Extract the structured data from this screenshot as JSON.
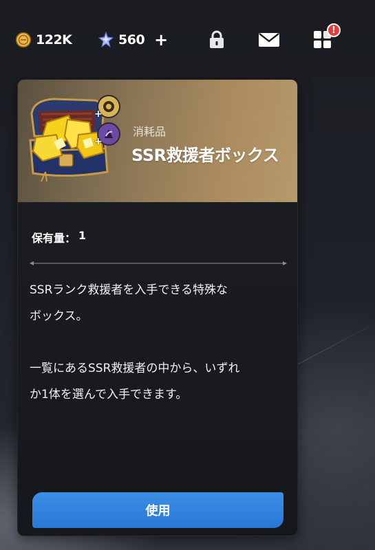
{
  "topbar": {
    "coins": {
      "icon": "coin-icon",
      "value": "122K"
    },
    "gems": {
      "icon": "gem-icon",
      "value": "560",
      "plus": "+"
    },
    "icons": [
      "lock-icon",
      "mail-icon",
      "menu-grid-icon"
    ],
    "notification": "!"
  },
  "item": {
    "type": "消耗品",
    "name": "SSR救援者ボックス",
    "owned_label": "保有量：",
    "owned_value": "1",
    "description": [
      "SSRランク救援者を入手できる特殊な\nボックス。",
      "一覧にあるSSR救援者の中から、いずれ\nか1体を選んで入手できます。"
    ],
    "use_label": "使用"
  },
  "colors": {
    "header_gold": "#a88a5e",
    "button_blue": "#2a78d6",
    "alert_red": "#e23b3b"
  }
}
